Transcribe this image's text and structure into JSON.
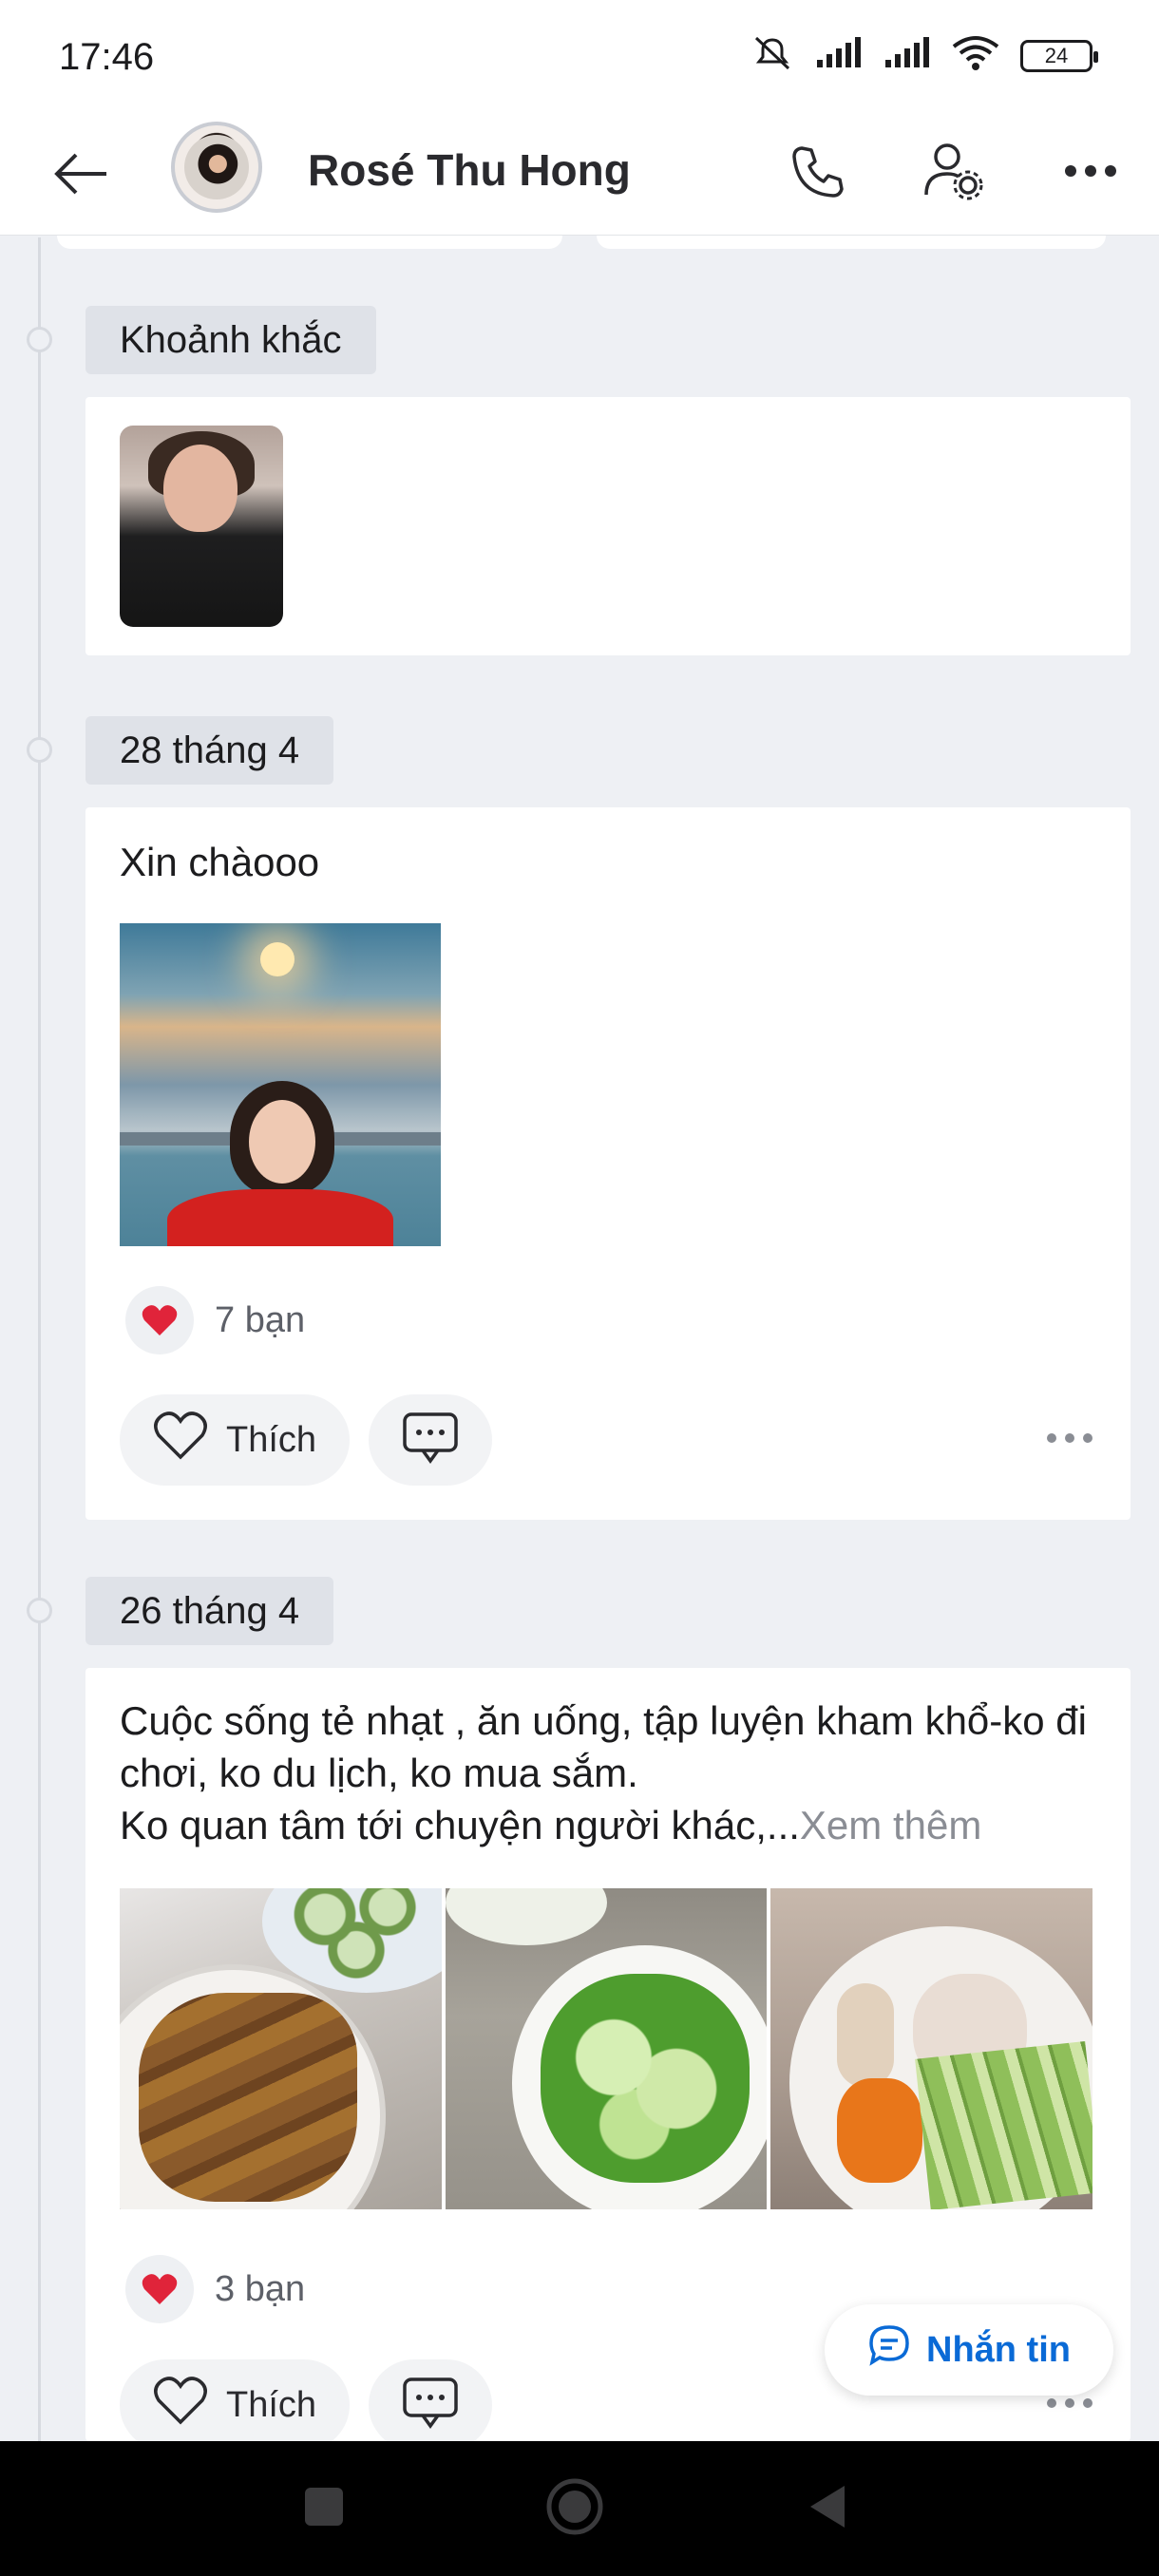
{
  "status_bar": {
    "time": "17:46",
    "battery": "24"
  },
  "header": {
    "title": "Rosé Thu Hong"
  },
  "sections": {
    "moments": {
      "label": "Khoảnh khắc"
    },
    "post1": {
      "date": "28 tháng 4",
      "text": "Xin chàooo",
      "reaction_count": "7 bạn",
      "like_label": "Thích"
    },
    "post2": {
      "date": "26 tháng 4",
      "text": "Cuộc sống tẻ nhạt , ăn uống, tập luyện kham khổ-ko đi chơi, ko du lịch, ko mua sắm.\nKo quan tâm tới chuyện người khác,...",
      "see_more": "Xem thêm",
      "reaction_count": "3 bạn",
      "like_label": "Thích"
    }
  },
  "fab": {
    "label": "Nhắn tin"
  },
  "colors": {
    "accent": "#0a6ad6",
    "heart": "#e0243a",
    "background": "#eef0f4"
  },
  "icons": [
    "back-arrow-icon",
    "phone-icon",
    "user-settings-icon",
    "more-icon",
    "heart-icon",
    "comment-icon",
    "chat-icon"
  ]
}
